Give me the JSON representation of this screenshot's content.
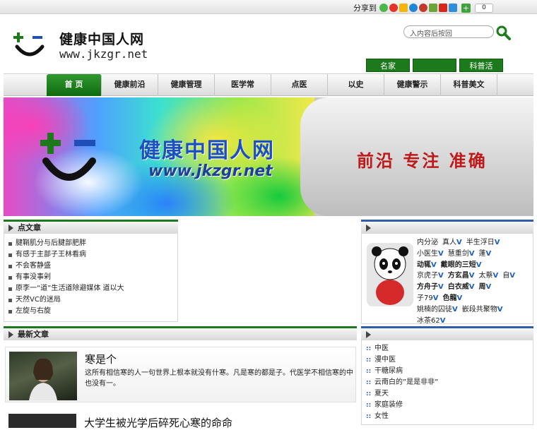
{
  "topbar": {
    "share_label": "分享到",
    "share_plus": "+",
    "share_count": "0"
  },
  "header": {
    "site_name": "健康中国人网",
    "site_url": "www.jkzgr.net",
    "search_placeholder": "入内容后按回",
    "topnav": [
      "名家",
      "",
      "科普活"
    ]
  },
  "nav": {
    "items": [
      "首  页",
      "健康前沿",
      "健康管理",
      "医学常",
      "点医",
      "以史",
      "健康警示",
      "科普美文"
    ]
  },
  "banner": {
    "title": "健康中国人网",
    "url": "www.jkzgr.net",
    "slogan": "前沿  专注  准确"
  },
  "hot": {
    "heading": "点文章",
    "items": [
      "腱鞘肌分与后腱部肥胖",
      "有感于主部子王林看病",
      "不会客静盛",
      "有事没事剁",
      "原李一“道”生活道除避媒体 道以大",
      "天然VC的迷局",
      "左旋与右旋"
    ]
  },
  "tags_panel": {
    "heading": "",
    "rows": [
      [
        [
          "内分泌",
          ""
        ],
        [
          "真人",
          "V"
        ],
        [
          "半生浮日",
          "V"
        ]
      ],
      [
        [
          "小医生",
          "V"
        ],
        [
          "慧重剑",
          "V"
        ],
        [
          "蓬",
          "V"
        ]
      ],
      [
        [
          "动辄",
          "V"
        ],
        [
          "戴眼的三短",
          "V"
        ]
      ],
      [
        [
          "京虎子",
          "V"
        ],
        [
          "方玄昌",
          "V"
        ],
        [
          "太蔡",
          "V"
        ],
        [
          "自",
          "V"
        ]
      ],
      [
        [
          "方舟子",
          "V"
        ],
        [
          "白衣威",
          "V"
        ],
        [
          "周",
          "V"
        ]
      ],
      [
        [
          "子79",
          "V"
        ],
        [
          "色龍",
          "V"
        ]
      ],
      [
        [
          "姚楠的囚徒",
          "V"
        ],
        [
          "嵌段共聚物",
          "V"
        ]
      ],
      [
        [
          "冰茶62",
          "V"
        ]
      ]
    ]
  },
  "latest": {
    "heading": "最新文章",
    "article1_title": "寒是个",
    "article1_summary": "这所有相信寒的人一句世界上根本就没有什寒。凡是寒的都是子。代医学不相信寒的中也没有一。",
    "article2_title": "大学生被光学后碎死心寒的命命"
  },
  "category": {
    "heading": "",
    "items": [
      "中医",
      "漫中医",
      "干糖尿病",
      "云南白的”是是非非”",
      "夏天",
      "家庭装修",
      "女性"
    ]
  },
  "colors": {
    "brand_green": "#1c7a1c",
    "panel_blue": "#2f5fa8",
    "slogan_red": "#c01818",
    "banner_blue": "#1c4fbf"
  }
}
